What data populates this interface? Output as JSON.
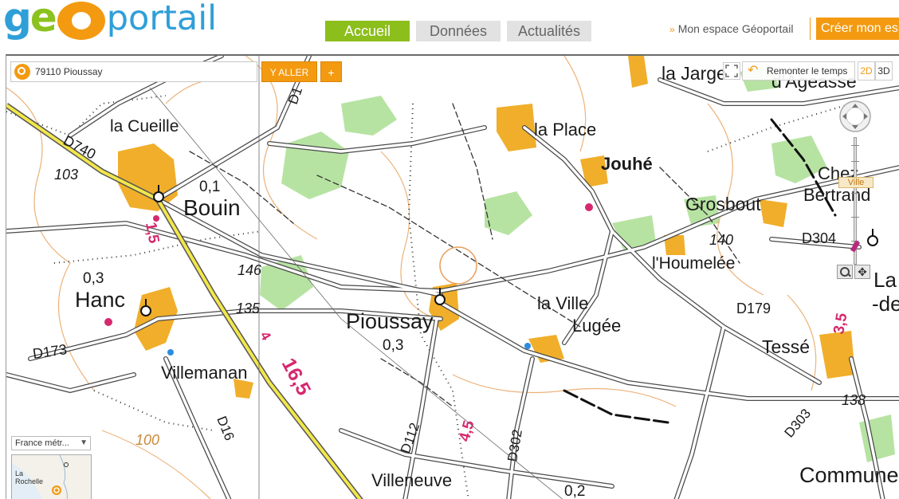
{
  "header": {
    "logo": {
      "prefix": "geo",
      "suffix": "portail"
    },
    "nav": [
      {
        "label": "Accueil",
        "active": true
      },
      {
        "label": "Données",
        "active": false
      },
      {
        "label": "Actualités",
        "active": false
      }
    ],
    "espace_link": "Mon espace Géoportail",
    "create_button": "Créer mon espace",
    "colors": {
      "brand_blue": "#2f9fd8",
      "brand_green": "#8cbe1c",
      "brand_orange": "#f39a11"
    }
  },
  "map_controls": {
    "search": {
      "value": "79110 Pioussay"
    },
    "yaller_label": "Y ALLER",
    "plus_label": "+",
    "remonter_label": "Remonter le temps",
    "mode_2d": "2D",
    "mode_3d": "3D",
    "zoom_level_label": "Ville",
    "territory_select": "France métr...",
    "overview_place": "La Rochelle"
  },
  "map": {
    "places": [
      "la Cueille",
      "Bouin",
      "Hanc",
      "Villemanan",
      "Pioussay",
      "la Place",
      "Jouhé",
      "Grosbout",
      "l'Houmelée",
      "la Ville",
      "Lugée",
      "Tessé",
      "Villeneuve",
      "Chez",
      "Bertrand",
      "la Jarge",
      "d'Ageasse",
      "La",
      "-de",
      "Commune"
    ],
    "roads": [
      "D740",
      "D173",
      "D16",
      "D112",
      "D302",
      "D179",
      "D304",
      "D303",
      "D1"
    ],
    "elevations": [
      "103",
      "146",
      "135",
      "100",
      "140",
      "138",
      "0,1",
      "0,3",
      "0,3",
      "0,2"
    ],
    "distances": [
      "1,5",
      "4",
      "16,5",
      "4,5",
      "3,5"
    ]
  }
}
